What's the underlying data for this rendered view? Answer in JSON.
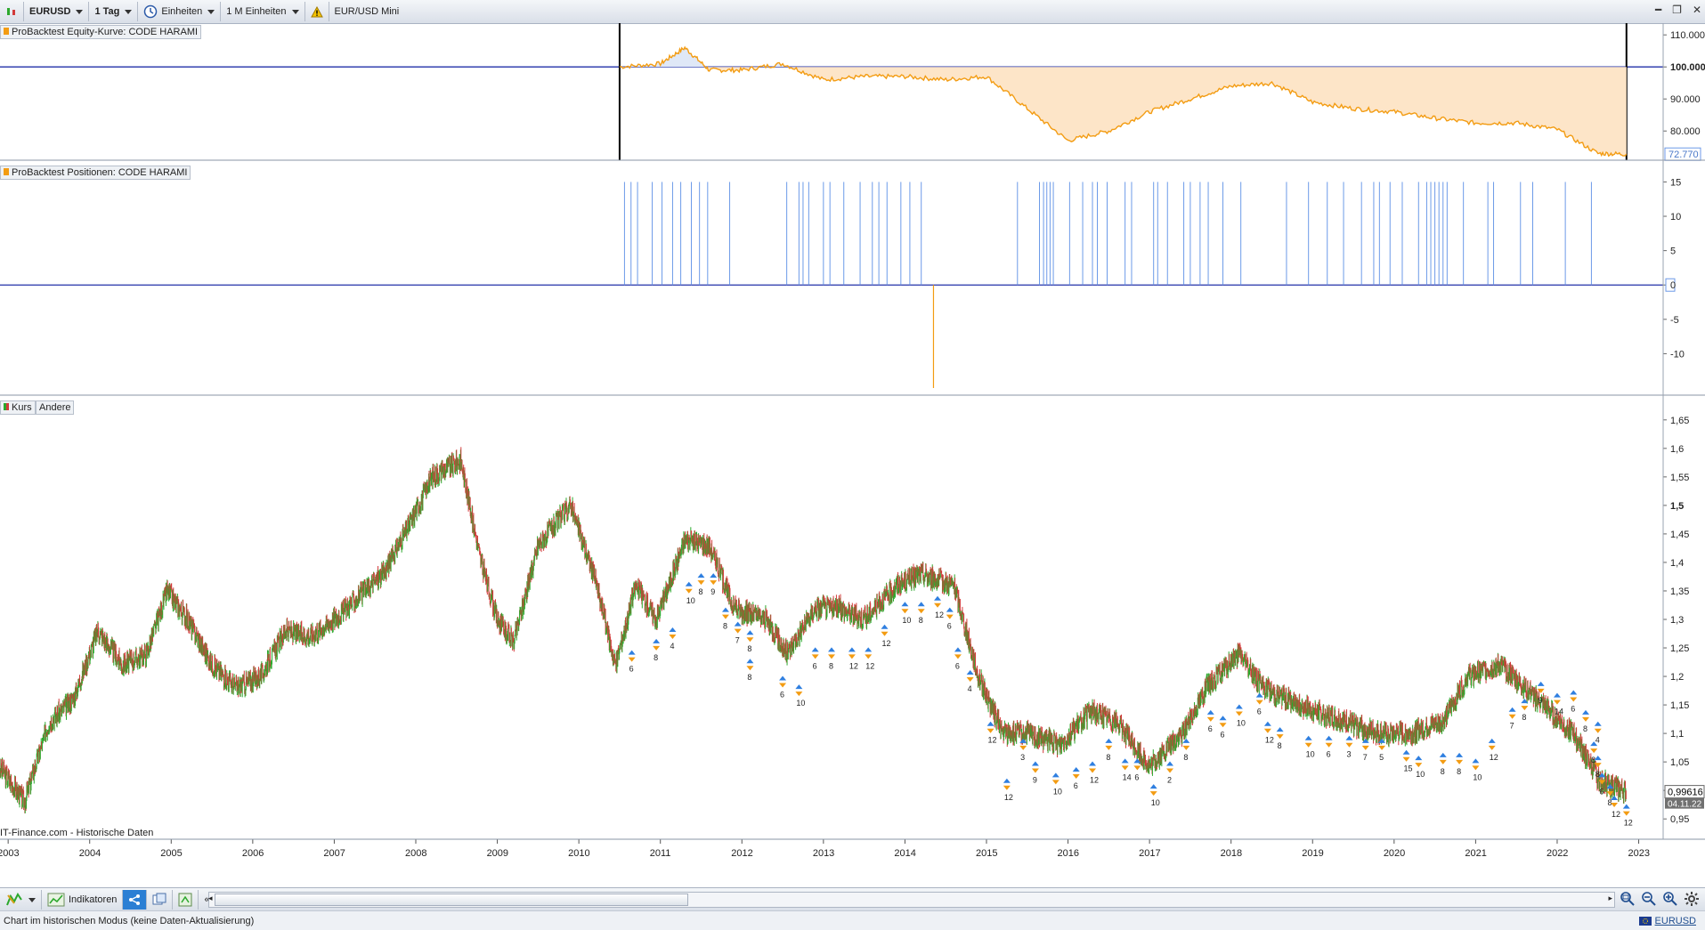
{
  "toolbar": {
    "symbol": "EURUSD",
    "timeframe": "1 Tag",
    "units": "Einheiten",
    "period": "1 M Einheiten",
    "product": "EUR/USD Mini"
  },
  "panels": {
    "equity": {
      "label": "ProBacktest Equity-Kurve: CODE HARAMI",
      "axis": [
        "110.000",
        "100.000",
        "90.000",
        "80.000"
      ],
      "last_value": "72.770"
    },
    "positions": {
      "label": "ProBacktest Positionen: CODE HARAMI",
      "axis": [
        "15",
        "10",
        "5",
        "0",
        "-5",
        "-10"
      ]
    },
    "price": {
      "label_kurs": "Kurs",
      "label_andere": "Andere",
      "axis": [
        "1,65",
        "1,6",
        "1,55",
        "1,5",
        "1,45",
        "1,4",
        "1,35",
        "1,3",
        "1,25",
        "1,2",
        "1,15",
        "1,1",
        "1,05",
        "1",
        "0,95"
      ],
      "last_price": "0,99616",
      "last_date": "04.11.22",
      "source": "IT-Finance.com - Historische Daten"
    }
  },
  "x_axis_years": [
    "2003",
    "2004",
    "2005",
    "2006",
    "2007",
    "2008",
    "2009",
    "2010",
    "2011",
    "2012",
    "2013",
    "2014",
    "2015",
    "2016",
    "2017",
    "2018",
    "2019",
    "2020",
    "2021",
    "2022",
    "2023"
  ],
  "bottom": {
    "indicators_label": "Indikatoren"
  },
  "status": {
    "text": "Chart im historischen Modus (keine Daten-Aktualisierung)",
    "symbol_link": "EURUSD"
  },
  "chart_data": [
    {
      "type": "area",
      "title": "ProBacktest Equity-Kurve: CODE HARAMI",
      "x": [
        2010.5,
        2011.0,
        2011.3,
        2011.6,
        2012.0,
        2012.5,
        2013.0,
        2013.5,
        2014.0,
        2014.5,
        2015.0,
        2015.5,
        2016.0,
        2016.5,
        2017.0,
        2017.5,
        2018.0,
        2018.5,
        2019.0,
        2019.5,
        2020.0,
        2020.5,
        2021.0,
        2021.5,
        2022.0,
        2022.5,
        2022.85
      ],
      "values": [
        100000,
        101000,
        106000,
        99000,
        99000,
        101000,
        96000,
        97000,
        97000,
        96000,
        97000,
        87000,
        77000,
        80000,
        86000,
        90000,
        94000,
        95000,
        89000,
        87000,
        86000,
        84000,
        82500,
        82500,
        80500,
        73000,
        72770
      ],
      "ylim": [
        72000,
        112000
      ],
      "baseline": 100000
    },
    {
      "type": "bar",
      "title": "ProBacktest Positionen: CODE HARAMI",
      "ylim": [
        -15,
        17
      ],
      "long_value": 15,
      "short_value": -15,
      "long_positions_x": [
        2010.56,
        2010.64,
        2010.72,
        2010.9,
        2011.02,
        2011.15,
        2011.25,
        2011.38,
        2011.48,
        2011.58,
        2011.85,
        2012.55,
        2012.7,
        2012.75,
        2012.82,
        2013.0,
        2013.08,
        2013.25,
        2013.45,
        2013.6,
        2013.68,
        2013.78,
        2013.95,
        2014.06,
        2014.2,
        2015.38,
        2015.65,
        2015.7,
        2015.74,
        2015.78,
        2015.82,
        2016.02,
        2016.18,
        2016.3,
        2016.36,
        2016.48,
        2016.7,
        2016.78,
        2017.05,
        2017.1,
        2017.22,
        2017.42,
        2017.5,
        2017.62,
        2017.72,
        2017.9,
        2018.12,
        2018.68,
        2018.95,
        2019.18,
        2019.38,
        2019.6,
        2019.75,
        2019.82,
        2019.95,
        2020.1,
        2020.3,
        2020.4,
        2020.45,
        2020.5,
        2020.55,
        2020.6,
        2020.65,
        2020.85,
        2021.15,
        2021.22,
        2021.55,
        2021.7,
        2022.1,
        2022.42
      ],
      "short_positions_x": [
        2014.35
      ]
    },
    {
      "type": "line",
      "title": "Kurs",
      "x": [
        2002.9,
        2003.2,
        2003.5,
        2003.8,
        2004.1,
        2004.4,
        2004.7,
        2004.95,
        2005.2,
        2005.5,
        2005.8,
        2006.1,
        2006.4,
        2006.7,
        2007.0,
        2007.3,
        2007.6,
        2007.9,
        2008.2,
        2008.55,
        2008.8,
        2009.0,
        2009.2,
        2009.5,
        2009.9,
        2010.2,
        2010.45,
        2010.7,
        2010.95,
        2011.3,
        2011.6,
        2011.9,
        2012.3,
        2012.55,
        2012.9,
        2013.2,
        2013.5,
        2013.9,
        2014.2,
        2014.6,
        2014.9,
        2015.2,
        2015.5,
        2015.9,
        2016.3,
        2016.6,
        2017.0,
        2017.4,
        2017.7,
        2018.1,
        2018.4,
        2018.7,
        2019.0,
        2019.4,
        2019.8,
        2020.2,
        2020.6,
        2020.9,
        2021.3,
        2021.6,
        2021.9,
        2022.2,
        2022.5,
        2022.85
      ],
      "values": [
        1.04,
        0.98,
        1.12,
        1.16,
        1.28,
        1.22,
        1.24,
        1.35,
        1.3,
        1.22,
        1.18,
        1.2,
        1.28,
        1.27,
        1.3,
        1.34,
        1.38,
        1.46,
        1.55,
        1.58,
        1.4,
        1.3,
        1.26,
        1.43,
        1.5,
        1.37,
        1.22,
        1.36,
        1.3,
        1.44,
        1.43,
        1.32,
        1.3,
        1.24,
        1.32,
        1.32,
        1.3,
        1.36,
        1.38,
        1.36,
        1.2,
        1.1,
        1.1,
        1.08,
        1.14,
        1.12,
        1.04,
        1.1,
        1.18,
        1.24,
        1.18,
        1.16,
        1.14,
        1.12,
        1.1,
        1.1,
        1.12,
        1.2,
        1.22,
        1.18,
        1.14,
        1.1,
        1.02,
        0.99616
      ],
      "ylim": [
        0.93,
        1.67
      ]
    }
  ],
  "trade_labels": [
    {
      "x": 2010.65,
      "y": 1.235,
      "n": "6"
    },
    {
      "x": 2010.95,
      "y": 1.255,
      "n": "8"
    },
    {
      "x": 2011.15,
      "y": 1.275,
      "n": "4"
    },
    {
      "x": 2011.35,
      "y": 1.355,
      "n": "10"
    },
    {
      "x": 2011.5,
      "y": 1.37,
      "n": "8"
    },
    {
      "x": 2011.65,
      "y": 1.37,
      "n": "9"
    },
    {
      "x": 2011.8,
      "y": 1.31,
      "n": "8"
    },
    {
      "x": 2011.95,
      "y": 1.285,
      "n": "7"
    },
    {
      "x": 2012.1,
      "y": 1.27,
      "n": "8"
    },
    {
      "x": 2012.1,
      "y": 1.22,
      "n": "8"
    },
    {
      "x": 2012.5,
      "y": 1.19,
      "n": "6"
    },
    {
      "x": 2012.7,
      "y": 1.175,
      "n": "10"
    },
    {
      "x": 2012.9,
      "y": 1.24,
      "n": "6"
    },
    {
      "x": 2013.1,
      "y": 1.24,
      "n": "8"
    },
    {
      "x": 2013.35,
      "y": 1.24,
      "n": "12"
    },
    {
      "x": 2013.55,
      "y": 1.24,
      "n": "12"
    },
    {
      "x": 2013.75,
      "y": 1.28,
      "n": "12"
    },
    {
      "x": 2014.0,
      "y": 1.32,
      "n": "10"
    },
    {
      "x": 2014.2,
      "y": 1.32,
      "n": "8"
    },
    {
      "x": 2014.4,
      "y": 1.33,
      "n": "12"
    },
    {
      "x": 2014.55,
      "y": 1.31,
      "n": "6"
    },
    {
      "x": 2014.65,
      "y": 1.24,
      "n": "6"
    },
    {
      "x": 2014.8,
      "y": 1.2,
      "n": "4"
    },
    {
      "x": 2015.05,
      "y": 1.11,
      "n": "12"
    },
    {
      "x": 2015.25,
      "y": 1.01,
      "n": "12"
    },
    {
      "x": 2015.45,
      "y": 1.08,
      "n": "3"
    },
    {
      "x": 2015.6,
      "y": 1.04,
      "n": "9"
    },
    {
      "x": 2015.85,
      "y": 1.02,
      "n": "10"
    },
    {
      "x": 2016.1,
      "y": 1.03,
      "n": "6"
    },
    {
      "x": 2016.3,
      "y": 1.04,
      "n": "12"
    },
    {
      "x": 2016.5,
      "y": 1.08,
      "n": "8"
    },
    {
      "x": 2016.7,
      "y": 1.045,
      "n": "14"
    },
    {
      "x": 2016.85,
      "y": 1.045,
      "n": "6"
    },
    {
      "x": 2017.05,
      "y": 1.0,
      "n": "10"
    },
    {
      "x": 2017.25,
      "y": 1.04,
      "n": "2"
    },
    {
      "x": 2017.45,
      "y": 1.08,
      "n": "8"
    },
    {
      "x": 2017.75,
      "y": 1.13,
      "n": "6"
    },
    {
      "x": 2017.9,
      "y": 1.12,
      "n": "6"
    },
    {
      "x": 2018.1,
      "y": 1.14,
      "n": "10"
    },
    {
      "x": 2018.35,
      "y": 1.16,
      "n": "6"
    },
    {
      "x": 2018.45,
      "y": 1.11,
      "n": "12"
    },
    {
      "x": 2018.6,
      "y": 1.1,
      "n": "8"
    },
    {
      "x": 2018.95,
      "y": 1.085,
      "n": "10"
    },
    {
      "x": 2019.2,
      "y": 1.085,
      "n": "6"
    },
    {
      "x": 2019.45,
      "y": 1.085,
      "n": "3"
    },
    {
      "x": 2019.65,
      "y": 1.08,
      "n": "7"
    },
    {
      "x": 2019.85,
      "y": 1.08,
      "n": "5"
    },
    {
      "x": 2020.15,
      "y": 1.06,
      "n": "15"
    },
    {
      "x": 2020.3,
      "y": 1.05,
      "n": "10"
    },
    {
      "x": 2020.6,
      "y": 1.055,
      "n": "8"
    },
    {
      "x": 2020.8,
      "y": 1.055,
      "n": "8"
    },
    {
      "x": 2021.0,
      "y": 1.045,
      "n": "10"
    },
    {
      "x": 2021.2,
      "y": 1.08,
      "n": "12"
    },
    {
      "x": 2021.45,
      "y": 1.135,
      "n": "7"
    },
    {
      "x": 2021.6,
      "y": 1.15,
      "n": "8"
    },
    {
      "x": 2021.8,
      "y": 1.18,
      "n": "9"
    },
    {
      "x": 2022.0,
      "y": 1.16,
      "n": "14"
    },
    {
      "x": 2022.2,
      "y": 1.165,
      "n": "6"
    },
    {
      "x": 2022.35,
      "y": 1.13,
      "n": "8"
    },
    {
      "x": 2022.5,
      "y": 1.11,
      "n": "4"
    },
    {
      "x": 2022.45,
      "y": 1.075,
      "n": "8"
    },
    {
      "x": 2022.5,
      "y": 1.05,
      "n": "8"
    },
    {
      "x": 2022.55,
      "y": 1.02,
      "n": "6"
    },
    {
      "x": 2022.65,
      "y": 1.0,
      "n": "8"
    },
    {
      "x": 2022.7,
      "y": 0.98,
      "n": "12"
    },
    {
      "x": 2022.85,
      "y": 0.965,
      "n": "12"
    }
  ],
  "colors": {
    "up": "#2ca82c",
    "down": "#d23a3a",
    "equity_line": "#f39c12",
    "equity_fill": "#fde5c8",
    "equity_above": "#4a78c8",
    "baseline": "#2230a8",
    "long_bar": "#6c9ae8",
    "short_bar": "#f39c12"
  }
}
